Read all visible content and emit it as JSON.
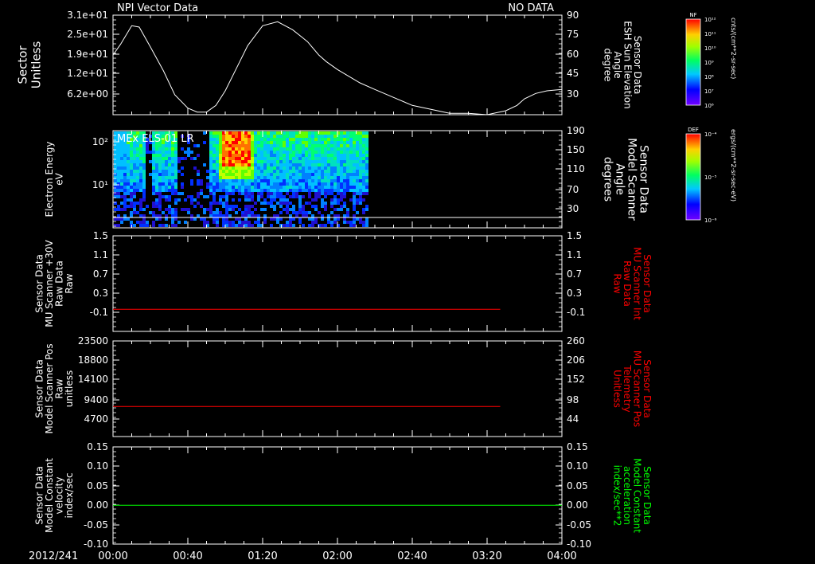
{
  "header": {
    "title": "NPI Vector Data",
    "status": "NO DATA",
    "date": "2012/241"
  },
  "time_axis": {
    "labels": [
      "00:00",
      "00:40",
      "01:20",
      "02:00",
      "02:40",
      "03:20",
      "04:00"
    ],
    "range_min": [
      0,
      240
    ]
  },
  "colors": {
    "white": "#ffffff",
    "red": "#ff0000",
    "green": "#00ff00"
  },
  "colorbars": [
    {
      "label": "NF",
      "unit": "cnts/(cm**2-sr-sec)",
      "ticks": [
        "10¹²",
        "10¹¹",
        "10¹⁰",
        "10⁹",
        "10⁸",
        "10⁷",
        "10⁶"
      ]
    },
    {
      "label": "DEF",
      "unit": "ergs/(cm**2-sr-sec-eV)",
      "ticks": [
        "10⁻⁴",
        "10⁻⁵",
        "10⁻⁶"
      ]
    }
  ],
  "chart_data": [
    {
      "type": "line",
      "panel": 1,
      "title": "NPI Vector Data",
      "ylabel_left": [
        "Sector",
        "Unitless"
      ],
      "yticks_left": [
        "3.1e+01",
        "2.5e+01",
        "1.9e+01",
        "1.2e+01",
        "6.2e+00"
      ],
      "ylabel_right": [
        "Sensor Data",
        "ESH Sun Elevation",
        "Angle",
        "degree"
      ],
      "yticks_right": [
        "90",
        "75",
        "60",
        "45",
        "30"
      ],
      "ylim_right": [
        15,
        90
      ],
      "series": [
        {
          "color": "white",
          "x": [
            0,
            4,
            10,
            14,
            20,
            27,
            33,
            40,
            45,
            50,
            55,
            60,
            66,
            72,
            80,
            88,
            96,
            104,
            110,
            114,
            120,
            126,
            132,
            140,
            150,
            160,
            170,
            180,
            190,
            200,
            210,
            216,
            220,
            226,
            232,
            240
          ],
          "y": [
            60,
            68,
            82,
            81,
            66,
            48,
            30,
            20,
            17,
            17,
            22,
            33,
            50,
            67,
            82,
            85,
            79,
            70,
            60,
            55,
            49,
            44,
            39,
            34,
            28,
            22,
            19,
            16,
            16,
            15,
            18,
            22,
            27,
            31,
            33,
            34
          ]
        }
      ]
    },
    {
      "type": "heatmap",
      "panel": 2,
      "title": "MEx ELS-01 LR",
      "ylabel_left": [
        "Electron Energy",
        "eV"
      ],
      "yticks_left": [
        "10²",
        "10¹"
      ],
      "ylabel_right": [
        "Sensor Data",
        "Model Scanner",
        "Angle",
        "degrees"
      ],
      "yticks_right": [
        "190",
        "150",
        "110",
        "70",
        "30"
      ],
      "data_extent_min": [
        0,
        136
      ]
    },
    {
      "type": "line",
      "panel": 3,
      "ylabel_left": [
        "Sensor Data",
        "MU Scanner +30V",
        "Raw Data",
        "Raw"
      ],
      "yticks_left": [
        "1.5",
        "1.1",
        "0.7",
        "0.3",
        "-0.1"
      ],
      "ylabel_right": [
        "Sensor Data",
        "MU Scanner Int",
        "Raw Data",
        "Raw"
      ],
      "yticks_right": [
        "1.5",
        "1.1",
        "0.7",
        "0.3",
        "-0.1"
      ],
      "ylim": [
        -0.45,
        1.5
      ],
      "series": [
        {
          "color": "red",
          "x": [
            0,
            207
          ],
          "y": [
            0,
            0
          ]
        }
      ]
    },
    {
      "type": "line",
      "panel": 4,
      "ylabel_left": [
        "Sensor Data",
        "Model Scanner Pos",
        "Raw",
        "unitless"
      ],
      "yticks_left": [
        "23500",
        "18800",
        "14100",
        "9400",
        "4700"
      ],
      "ylabel_right": [
        "Sensor Data",
        "MU Scanner Pos",
        "Telemetry",
        "Unitless"
      ],
      "yticks_right": [
        "260",
        "206",
        "152",
        "98",
        "44"
      ],
      "ylim": [
        0,
        23500
      ],
      "series": [
        {
          "color": "red",
          "x": [
            0,
            207
          ],
          "y": [
            7400,
            7400
          ]
        }
      ]
    },
    {
      "type": "line",
      "panel": 5,
      "ylabel_left": [
        "Sensor Data",
        "Model Constant",
        "velocity",
        "index/sec"
      ],
      "yticks_left": [
        "0.15",
        "0.10",
        "0.05",
        "0.00",
        "-0.05",
        "-0.10"
      ],
      "ylabel_right": [
        "Sensor Data",
        "Model Constant",
        "acceleration",
        "index/sec**2"
      ],
      "yticks_right": [
        "0.15",
        "0.10",
        "0.05",
        "0.00",
        "-0.05",
        "-0.10"
      ],
      "ylim": [
        -0.1,
        0.15
      ],
      "series": [
        {
          "color": "green",
          "x": [
            0,
            240
          ],
          "y": [
            0,
            0
          ]
        }
      ]
    }
  ]
}
